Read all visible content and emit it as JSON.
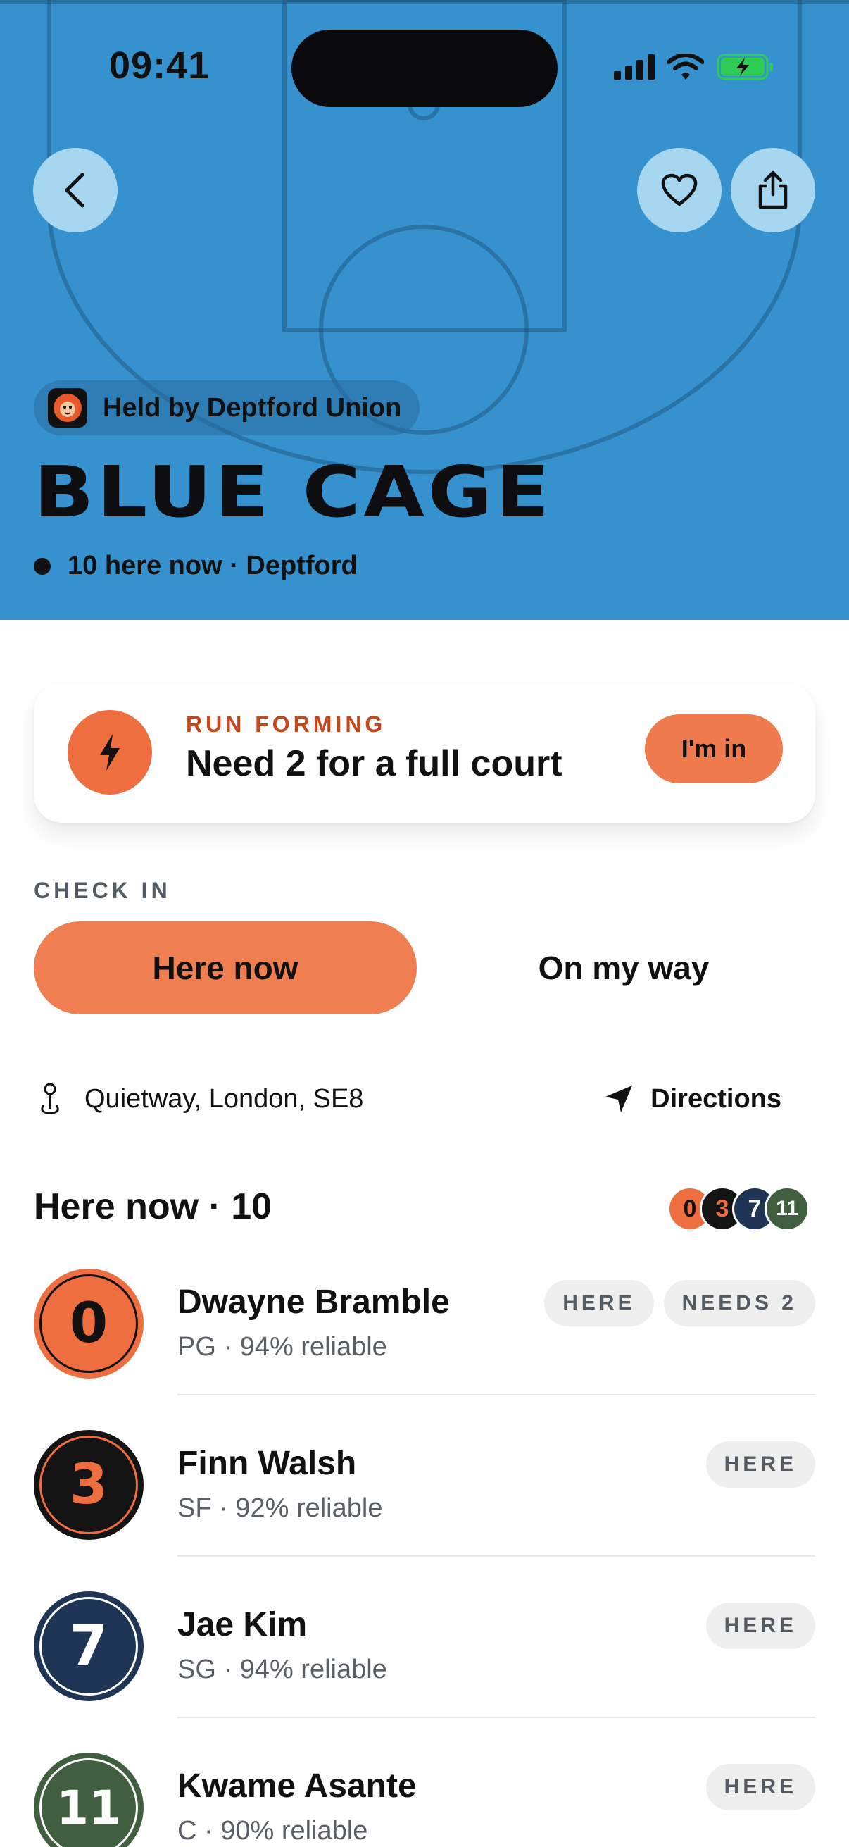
{
  "status_bar": {
    "time": "09:41"
  },
  "hero": {
    "background_color": "#3592CE",
    "org_label": "Held by Deptford Union",
    "title": "BLUE CAGE",
    "presence": "10 here now · Deptford"
  },
  "run_card": {
    "kicker": "RUN FORMING",
    "title": "Need 2 for a full court",
    "action_label": "I'm in",
    "accent_color": "#EE6E3F"
  },
  "check_in": {
    "label": "CHECK IN",
    "options": [
      "Here now",
      "On my way"
    ],
    "selected": "Here now"
  },
  "location": {
    "address": "Quietway, London, SE8",
    "directions_label": "Directions"
  },
  "here_now": {
    "title": "Here now · 10",
    "stack": [
      "0",
      "3",
      "7",
      "11"
    ],
    "players": [
      {
        "number": "0",
        "name": "Dwayne Bramble",
        "meta": "PG · 94% reliable",
        "tags": [
          "HERE",
          "NEEDS 2"
        ]
      },
      {
        "number": "3",
        "name": "Finn Walsh",
        "meta": "SF · 92% reliable",
        "tags": [
          "HERE"
        ]
      },
      {
        "number": "7",
        "name": "Jae Kim",
        "meta": "SG · 94% reliable",
        "tags": [
          "HERE"
        ]
      },
      {
        "number": "11",
        "name": "Kwame Asante",
        "meta": "C · 90% reliable",
        "tags": [
          "HERE"
        ]
      }
    ]
  }
}
